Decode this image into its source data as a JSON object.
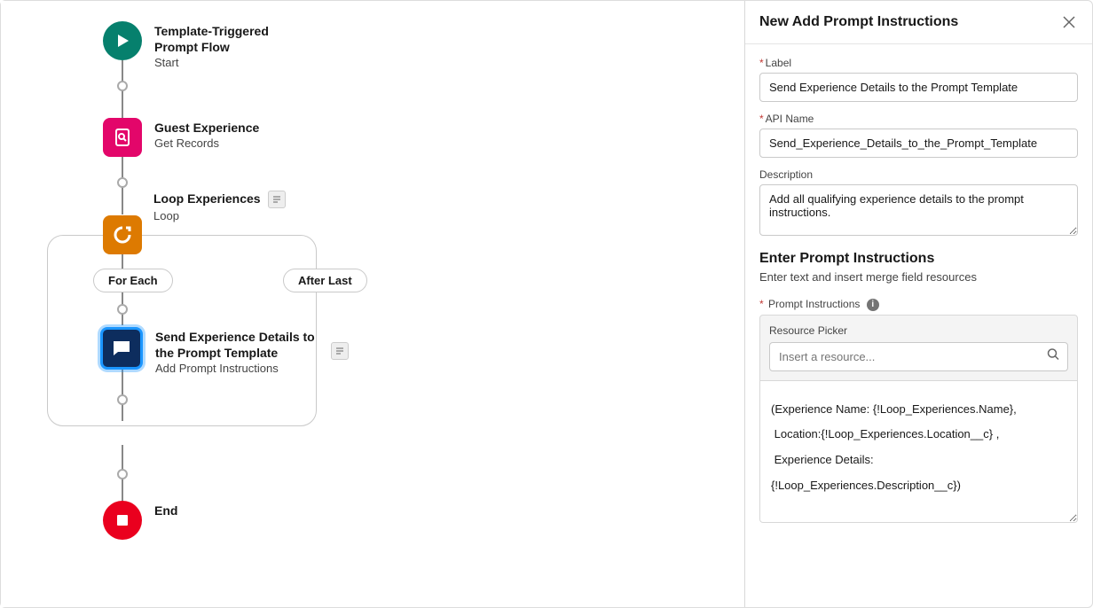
{
  "canvas": {
    "nodes": {
      "start": {
        "title": "Template-Triggered Prompt Flow",
        "subtitle": "Start"
      },
      "records": {
        "title": "Guest Experience",
        "subtitle": "Get Records"
      },
      "loop": {
        "title": "Loop Experiences",
        "subtitle": "Loop"
      },
      "prompt": {
        "title": "Send Experience Details to the Prompt Template",
        "subtitle": "Add Prompt Instructions"
      },
      "end": {
        "title": "End"
      }
    },
    "pills": {
      "for_each": "For Each",
      "after_last": "After Last"
    }
  },
  "panel": {
    "header": "New Add Prompt Instructions",
    "fields": {
      "label_label": "Label",
      "label_value": "Send Experience Details to the Prompt Template",
      "api_label": "API Name",
      "api_value": "Send_Experience_Details_to_the_Prompt_Template",
      "desc_label": "Description",
      "desc_value": "Add all qualifying experience details to the prompt instructions."
    },
    "section": {
      "title": "Enter Prompt Instructions",
      "desc": "Enter text and insert merge field resources",
      "prompt_label": "Prompt Instructions",
      "resource_label": "Resource Picker",
      "resource_placeholder": "Insert a resource...",
      "prompt_value": "(Experience Name: {!Loop_Experiences.Name},\n Location:{!Loop_Experiences.Location__c} ,\n Experience Details: {!Loop_Experiences.Description__c})"
    }
  }
}
